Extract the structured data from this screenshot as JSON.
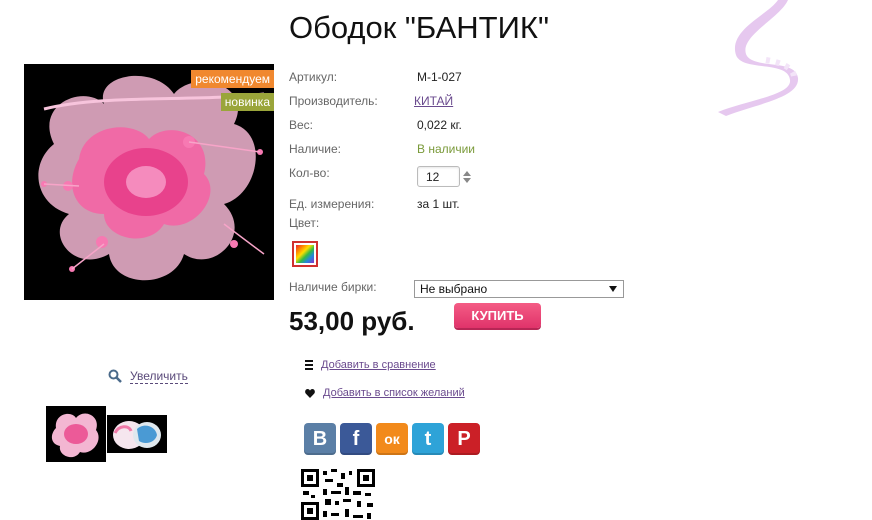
{
  "product": {
    "title": "Ободок \"БАНТИК\"",
    "badges": {
      "recommend": "рекомендуем",
      "new": "новинка"
    },
    "zoom_label": "Увеличить"
  },
  "props": {
    "article": {
      "label": "Артикул:",
      "value": "М-1-027"
    },
    "maker": {
      "label": "Производитель:",
      "value": "КИТАЙ"
    },
    "weight": {
      "label": "Вес:",
      "value": "0,022 кг."
    },
    "stock": {
      "label": "Наличие:",
      "value": "В наличии"
    },
    "qty": {
      "label": "Кол-во:",
      "value": "12"
    },
    "unit": {
      "label": "Ед. измерения:",
      "value": "за 1 шт."
    },
    "color": {
      "label": "Цвет:"
    },
    "tag": {
      "label": "Наличие бирки:",
      "selected": "Не выбрано"
    }
  },
  "price": "53,00 руб.",
  "buy_label": "КУПИТЬ",
  "actions": {
    "compare": "Добавить в сравнение",
    "wishlist": "Добавить в список желаний"
  },
  "social": {
    "vk": "В",
    "fb": "f",
    "ok": "ок",
    "tw": "t",
    "pi": "P"
  },
  "colors": {
    "link": "#6a4a8e",
    "stock": "#7a9a3a",
    "buy": "#e0336a",
    "badge_recommend": "#f0882f",
    "badge_new": "#9aa53a"
  },
  "icons": {
    "zoom": "magnifier-icon",
    "compare": "list-icon",
    "wishlist": "heart-icon",
    "color": "multicolor-swatch"
  }
}
